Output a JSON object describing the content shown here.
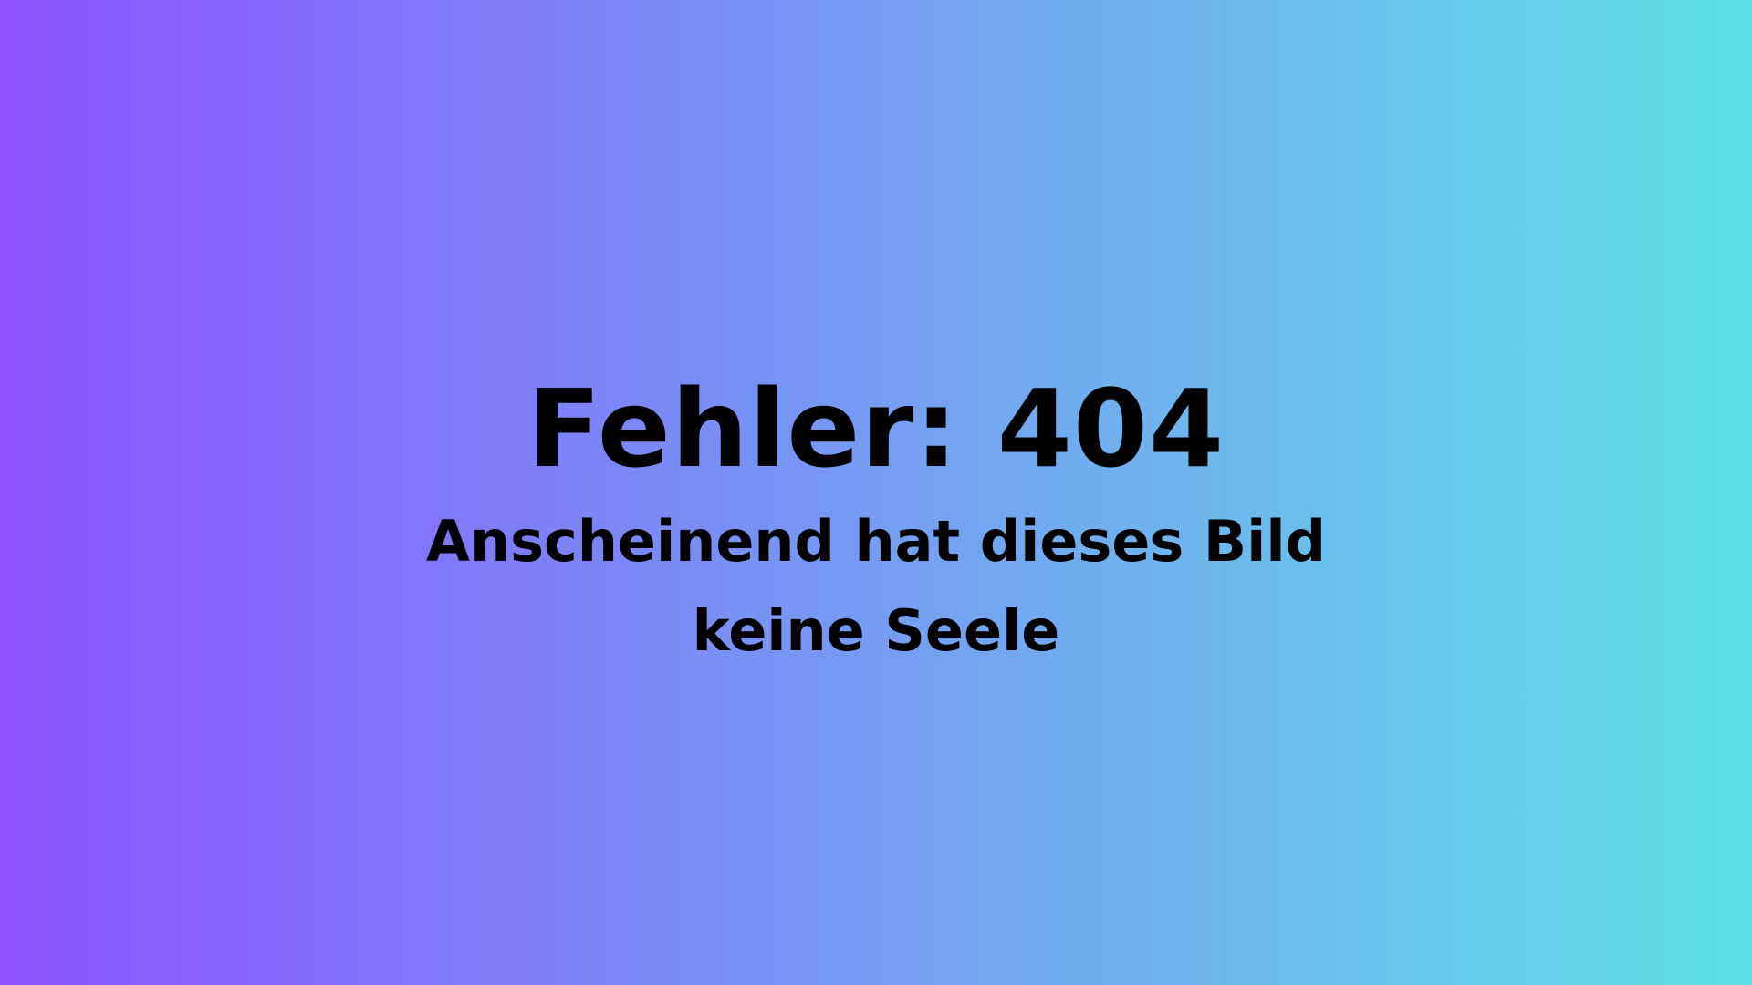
{
  "error": {
    "title": "Fehler: 404",
    "message_line1": "Anscheinend hat dieses Bild",
    "message_line2": "keine Seele"
  },
  "colors": {
    "gradient_start": "#8c52ff",
    "gradient_end": "#5de0e6",
    "text": "#000000"
  }
}
